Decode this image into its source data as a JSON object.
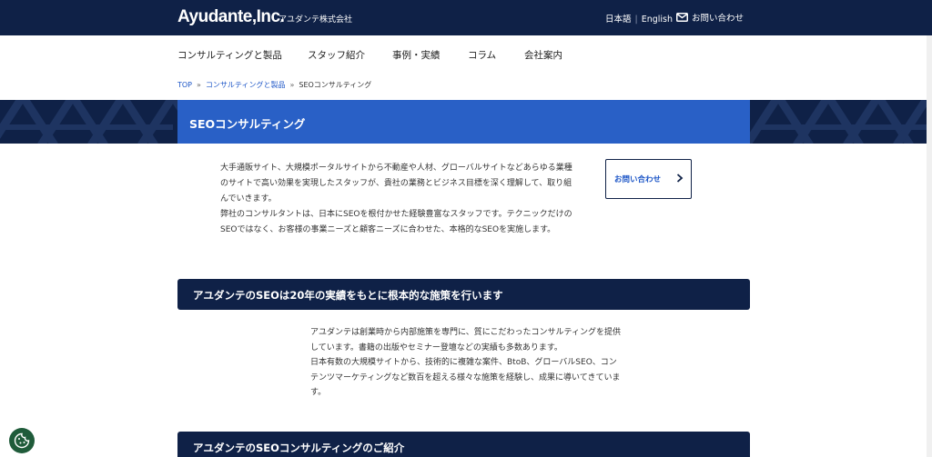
{
  "header": {
    "logo": "Ayudante,Inc.",
    "logo_sub": "アユダンテ株式会社",
    "lang_ja": "日本語",
    "lang_en": "English",
    "contact": "お問い合わせ"
  },
  "nav": {
    "items": [
      {
        "label": "コンサルティングと製品"
      },
      {
        "label": "スタッフ紹介"
      },
      {
        "label": "事例・実績"
      },
      {
        "label": "コラム"
      },
      {
        "label": "会社案内"
      }
    ]
  },
  "breadcrumb": {
    "items": [
      "TOP",
      "コンサルティングと製品",
      "SEOコンサルティング"
    ],
    "separator": "»"
  },
  "hero": {
    "title": "SEOコンサルティング"
  },
  "intro": {
    "paragraphs": [
      "大手通販サイト、大規模ポータルサイトから不動産や人材、グローバルサイトなどあらゆる業種のサイトで高い効果を実現したスタッフが、貴社の業務とビジネス目標を深く理解して、取り組んでいきます。",
      "弊社のコンサルタントは、日本にSEOを根付かせた経験豊富なスタッフです。テクニックだけのSEOではなく、お客様の事業ニーズと顧客ニーズに合わせた、本格的なSEOを実施します。"
    ],
    "contact_button": "お問い合わせ"
  },
  "section1": {
    "heading": "アユダンテのSEOは20年の実績をもとに根本的な施策を行います",
    "paragraphs": [
      "アユダンテは創業時から内部施策を専門に、質にこだわったコンサルティングを提供しています。書籍の出版やセミナー登壇などの実績も多数あります。",
      "日本有数の大規模サイトから、技術的に複雑な案件、BtoB、グローバルSEO、コンテンツマーケティングなど数百を超える様々な施策を経験し、成果に導いてきています。"
    ]
  },
  "section2": {
    "heading": "アユダンテのSEOコンサルティングのご紹介"
  },
  "colors": {
    "navy": "#0f2147",
    "blue": "#2960c6",
    "link": "#1d56c7",
    "cookie": "#1f5b3a"
  },
  "icons": {
    "contact": "envelope-icon",
    "chevron": "chevron-right-icon",
    "cookie": "cookie-icon"
  }
}
